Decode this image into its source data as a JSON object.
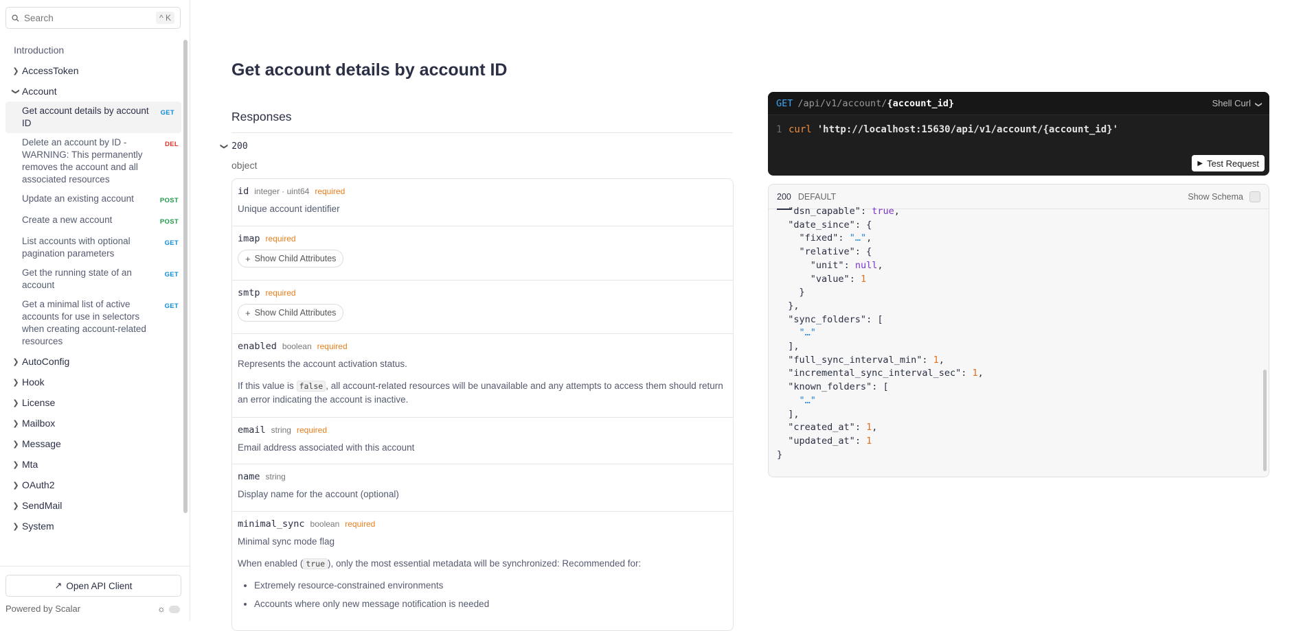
{
  "sidebar": {
    "search_placeholder": "Search",
    "search_shortcut": "^ K",
    "intro": "Introduction",
    "groups": [
      {
        "label": "AccessToken"
      },
      {
        "label": "Account"
      },
      {
        "label": "AutoConfig"
      },
      {
        "label": "Hook"
      },
      {
        "label": "License"
      },
      {
        "label": "Mailbox"
      },
      {
        "label": "Message"
      },
      {
        "label": "Mta"
      },
      {
        "label": "OAuth2"
      },
      {
        "label": "SendMail"
      },
      {
        "label": "System"
      }
    ],
    "account_endpoints": [
      {
        "label": "Get account details by account ID",
        "method": "GET"
      },
      {
        "label": "Delete an account by ID - WARNING: This permanently removes the account and all associated resources",
        "method": "DEL"
      },
      {
        "label": "Update an existing account",
        "method": "POST"
      },
      {
        "label": "Create a new account",
        "method": "POST"
      },
      {
        "label": "List accounts with optional pagination parameters",
        "method": "GET"
      },
      {
        "label": "Get the running state of an account",
        "method": "GET"
      },
      {
        "label": "Get a minimal list of active accounts for use in selectors when creating account-related resources",
        "method": "GET"
      }
    ],
    "open_client": "Open API Client",
    "powered_by": "Powered by Scalar"
  },
  "main": {
    "title": "Get account details by account ID",
    "responses_heading": "Responses",
    "status_code": "200",
    "object_type": "object",
    "show_child": "Show Child Attributes",
    "props": {
      "id": {
        "name": "id",
        "type": "integer · uint64",
        "req": "required",
        "desc": "Unique account identifier"
      },
      "imap": {
        "name": "imap",
        "req": "required"
      },
      "smtp": {
        "name": "smtp",
        "req": "required"
      },
      "enabled": {
        "name": "enabled",
        "type": "boolean",
        "req": "required",
        "desc": "Represents the account activation status.",
        "note_pre": "If this value is",
        "note_code": "false",
        "note_post": ", all account-related resources will be unavailable and any attempts to access them should return an error indicating the account is inactive."
      },
      "email": {
        "name": "email",
        "type": "string",
        "req": "required",
        "desc": "Email address associated with this account"
      },
      "name": {
        "name": "name",
        "type": "string",
        "desc": "Display name for the account (optional)"
      },
      "minimal_sync": {
        "name": "minimal_sync",
        "type": "boolean",
        "req": "required",
        "desc": "Minimal sync mode flag",
        "note_pre": "When enabled (",
        "note_code": "true",
        "note_post": "), only the most essential metadata will be synchronized: Recommended for:",
        "bullets": [
          "Extremely resource-constrained environments",
          "Accounts where only new message notification is needed"
        ]
      }
    }
  },
  "request": {
    "method": "GET",
    "path": "/api/v1/account/",
    "param": "{account_id}",
    "client": "Shell Curl",
    "line_no": "1",
    "cmd": "curl",
    "url": "'http://localhost:15630/api/v1/account/{account_id}'",
    "test_button": "Test Request"
  },
  "response": {
    "tab_status": "200",
    "tab_default": "DEFAULT",
    "show_schema": "Show Schema"
  }
}
